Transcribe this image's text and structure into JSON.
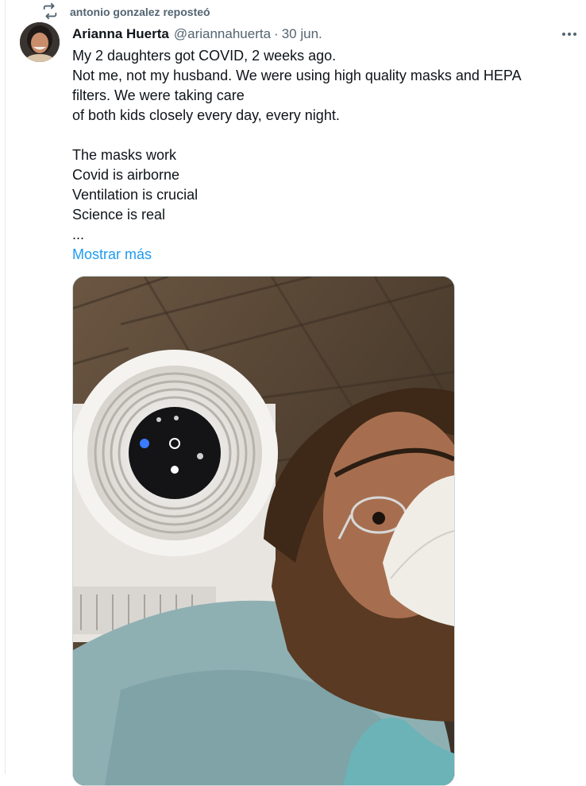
{
  "repost": {
    "icon": "repost-icon",
    "text": "antonio gonzalez reposteó"
  },
  "tweet": {
    "author": {
      "name": "Arianna Huerta",
      "handle": "@ariannahuerta",
      "avatar_icon": "avatar"
    },
    "separator": "·",
    "date": "30 jun.",
    "more_icon": "more-icon",
    "text_lines": [
      "My 2 daughters got COVID, 2 weeks ago.",
      "Not me, not my husband. We were using high quality masks and HEPA",
      "filters. We were taking care",
      "of both kids closely every day, every night.",
      "",
      "The masks work",
      "Covid is airborne",
      "Ventilation is crucial",
      "Science is real",
      "..."
    ],
    "show_more": "Mostrar más",
    "media": {
      "description_icon": "photo-image"
    }
  },
  "colors": {
    "link": "#1d9bf0",
    "secondary": "#536471",
    "primary_text": "#0f1419"
  }
}
